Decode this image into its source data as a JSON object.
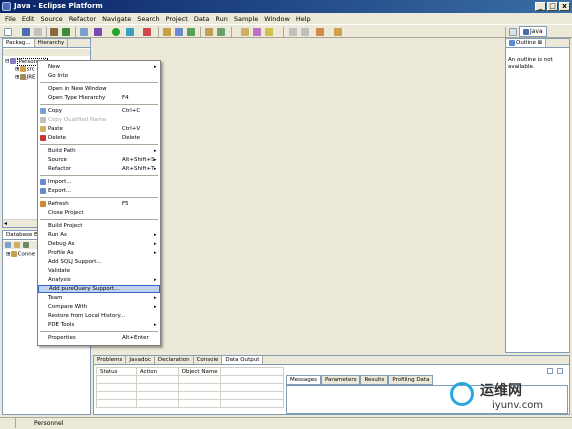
{
  "window": {
    "title": "Java - Eclipse Platform",
    "min": "_",
    "max": "□",
    "close": "x"
  },
  "menubar": [
    "File",
    "Edit",
    "Source",
    "Refactor",
    "Navigate",
    "Search",
    "Project",
    "Data",
    "Run",
    "Sample",
    "Window",
    "Help"
  ],
  "perspective": {
    "label": "Java"
  },
  "left_top_view": {
    "tabs": [
      "Packag...",
      "Hierarchy"
    ],
    "tree": [
      "Personnel",
      "src",
      "JRE"
    ]
  },
  "left_bottom_view": {
    "tabs": [
      "Database E"
    ],
    "tree": [
      "Conne"
    ]
  },
  "outline": {
    "tab": "Outline",
    "message": "An outline is not available."
  },
  "context_menu": [
    {
      "label": "New",
      "submenu": true
    },
    {
      "label": "Go Into"
    },
    {
      "sep": true
    },
    {
      "label": "Open in New Window"
    },
    {
      "label": "Open Type Hierarchy",
      "accel": "F4"
    },
    {
      "sep": true
    },
    {
      "label": "Copy",
      "accel": "Ctrl+C",
      "icon": "copy-icon"
    },
    {
      "label": "Copy Qualified Name",
      "disabled": true,
      "icon": "copy-qualified-icon"
    },
    {
      "label": "Paste",
      "accel": "Ctrl+V",
      "icon": "paste-icon"
    },
    {
      "label": "Delete",
      "accel": "Delete",
      "icon": "delete-icon"
    },
    {
      "sep": true
    },
    {
      "label": "Build Path",
      "submenu": true
    },
    {
      "label": "Source",
      "accel": "Alt+Shift+S",
      "submenu": true
    },
    {
      "label": "Refactor",
      "accel": "Alt+Shift+T",
      "submenu": true
    },
    {
      "sep": true
    },
    {
      "label": "Import...",
      "icon": "import-icon"
    },
    {
      "label": "Export...",
      "icon": "export-icon"
    },
    {
      "sep": true
    },
    {
      "label": "Refresh",
      "accel": "F5",
      "icon": "refresh-icon"
    },
    {
      "label": "Close Project"
    },
    {
      "sep": true
    },
    {
      "label": "Build Project"
    },
    {
      "label": "Run As",
      "submenu": true
    },
    {
      "label": "Debug As",
      "submenu": true
    },
    {
      "label": "Profile As",
      "submenu": true
    },
    {
      "label": "Add SQLJ Support..."
    },
    {
      "label": "Validate"
    },
    {
      "label": "Analysis",
      "submenu": true
    },
    {
      "label": "Add pureQuery Support...",
      "highlighted": true
    },
    {
      "label": "Team",
      "submenu": true
    },
    {
      "label": "Compare With",
      "submenu": true
    },
    {
      "label": "Restore from Local History..."
    },
    {
      "label": "PDE Tools",
      "submenu": true
    },
    {
      "sep": true
    },
    {
      "label": "Properties",
      "accel": "Alt+Enter"
    }
  ],
  "bottom_panel": {
    "tabs": [
      "Problems",
      "Javadoc",
      "Declaration",
      "Console",
      "Data Output"
    ],
    "columns": [
      "Status",
      "Action",
      "Object Name"
    ],
    "right_tabs": [
      "Messages",
      "Parameters",
      "Results",
      "Profiling Data"
    ]
  },
  "watermark": {
    "text": "运维网",
    "url": "iyunv.com"
  },
  "status": {
    "text": "Personnel"
  }
}
